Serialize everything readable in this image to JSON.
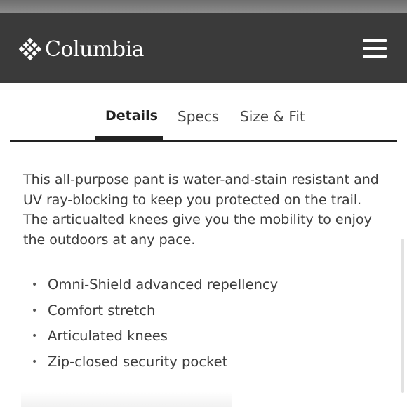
{
  "header": {
    "brand": "Columbia",
    "logo_icon": "columbia-diamond-logo",
    "menu_icon": "hamburger-menu-icon"
  },
  "tabs": [
    {
      "label": "Details",
      "active": true
    },
    {
      "label": "Specs",
      "active": false
    },
    {
      "label": "Size & Fit",
      "active": false
    }
  ],
  "details": {
    "description": "This all-purpose pant is water-and-stain resistant and UV ray-blocking to keep you protected on the trail. The articualted knees give you the mobility to enjoy the outdoors at any pace.",
    "features": [
      "Omni-Shield advanced repellency",
      "Comfort stretch",
      "Articulated knees",
      "Zip-closed security pocket"
    ]
  },
  "colors": {
    "header_bg": "#3a3a3a",
    "text": "#3c3c3c",
    "accent": "#222222"
  }
}
